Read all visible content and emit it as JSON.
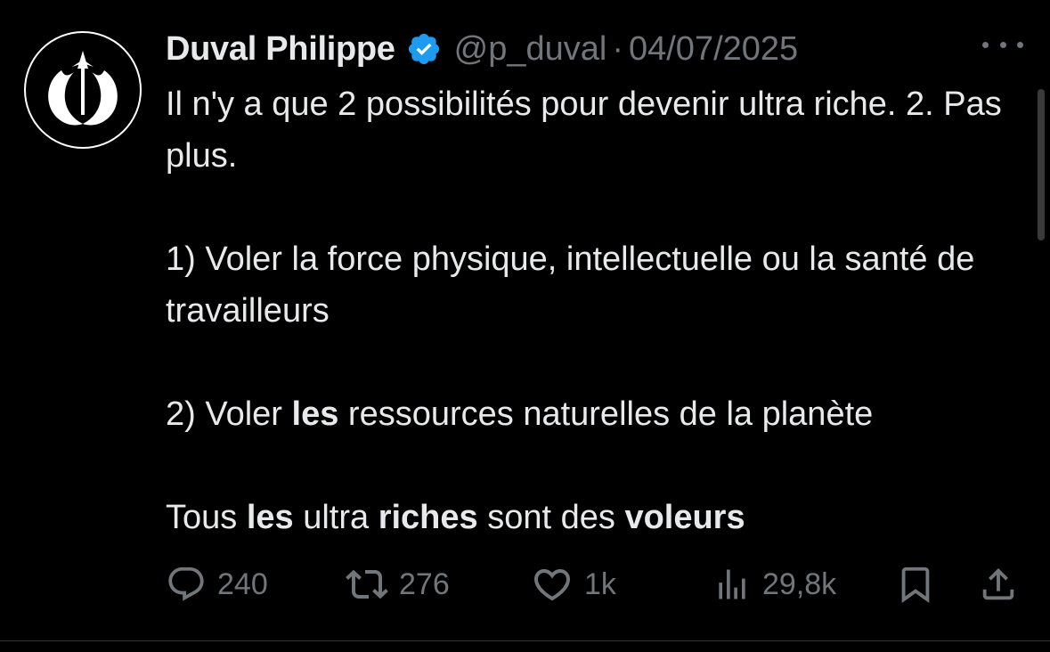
{
  "tweet": {
    "display_name": "Duval Philippe",
    "handle": "@p_duval",
    "separator": "·",
    "date": "04/07/2025",
    "verified_color": "#1d9bf0",
    "avatar_icon": "rebel-alliance-icon",
    "body": {
      "line1": "Il n'y a que 2 possibilités pour devenir ultra riche.  2. Pas plus.",
      "point1": "1) Voler la force physique,  intellectuelle ou la santé de travailleurs",
      "point2_prefix": "2) Voler ",
      "point2_bold": "les",
      "point2_suffix": " ressources naturelles de la planète",
      "conclusion_1": "Tous ",
      "conclusion_2": "les",
      "conclusion_3": " ultra ",
      "conclusion_4": "riches",
      "conclusion_5": " sont des ",
      "conclusion_6": "voleurs"
    },
    "actions": {
      "replies": "240",
      "retweets": "276",
      "likes": "1k",
      "views": "29,8k"
    }
  }
}
